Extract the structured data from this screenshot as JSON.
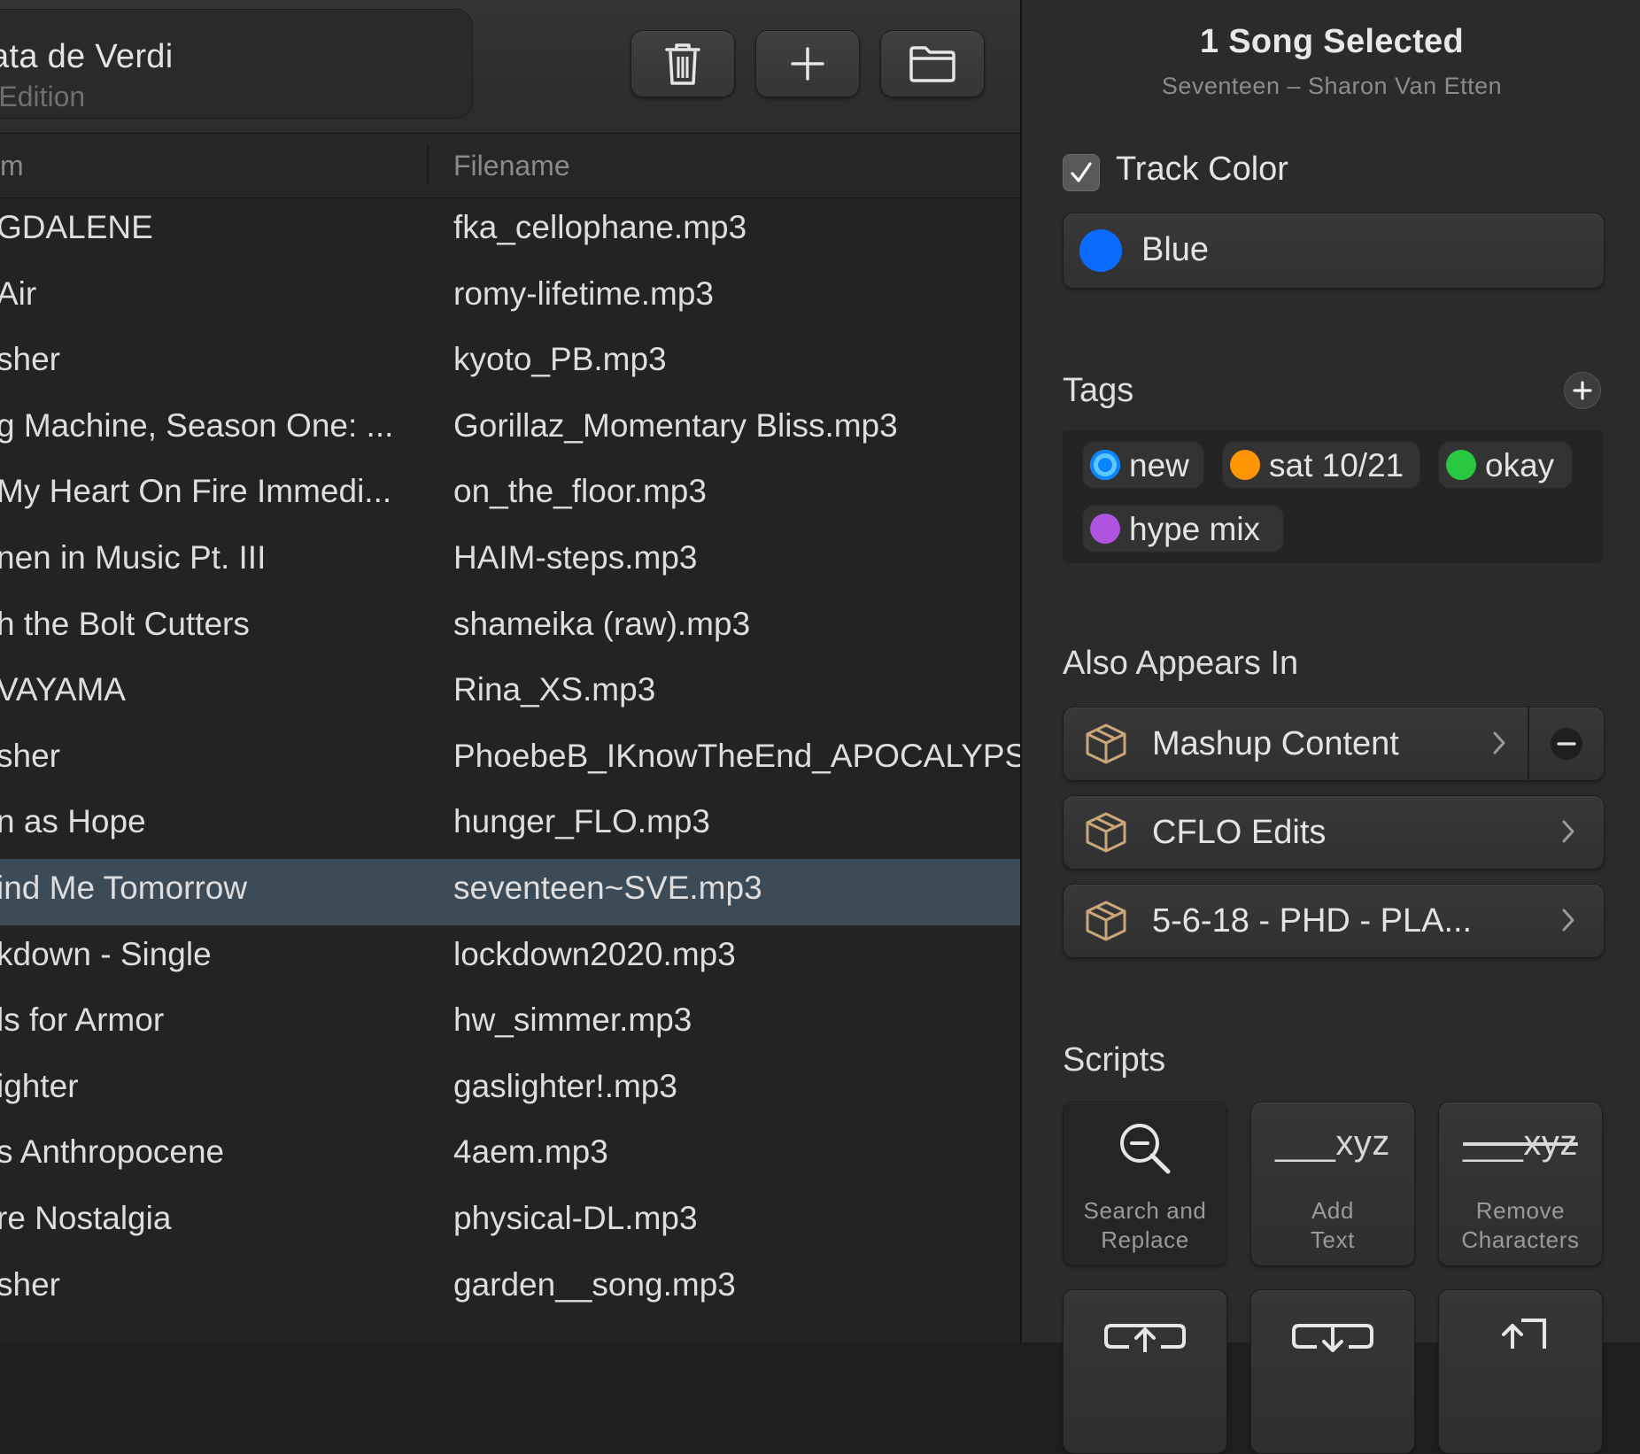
{
  "toolbar": {
    "title": "viata de Verdi",
    "subtitle": "ar Edition",
    "icons": [
      "trash-icon",
      "plus-icon",
      "folder-icon"
    ]
  },
  "columns": {
    "album": "m",
    "filename": "Filename"
  },
  "rows": [
    {
      "album": "GDALENE",
      "filename": "fka_cellophane.mp3"
    },
    {
      "album": "Air",
      "filename": "romy-lifetime.mp3"
    },
    {
      "album": "sher",
      "filename": "kyoto_PB.mp3"
    },
    {
      "album": "g Machine, Season One: ...",
      "filename": "Gorillaz_Momentary Bliss.mp3"
    },
    {
      "album": "My Heart On Fire Immedi...",
      "filename": "on_the_floor.mp3"
    },
    {
      "album": "nen in Music Pt. III",
      "filename": "HAIM-steps.mp3"
    },
    {
      "album": "h the Bolt Cutters",
      "filename": "shameika (raw).mp3"
    },
    {
      "album": "VAYAMA",
      "filename": "Rina_XS.mp3"
    },
    {
      "album": "sher",
      "filename": "PhoebeB_IKnowTheEnd_APOCALYPSE"
    },
    {
      "album": "n as Hope",
      "filename": "hunger_FLO.mp3"
    },
    {
      "album": "ind Me Tomorrow",
      "filename": "seventeen~SVE.mp3",
      "selected": true
    },
    {
      "album": "kdown - Single",
      "filename": "lockdown2020.mp3"
    },
    {
      "album": "ls for Armor",
      "filename": "hw_simmer.mp3"
    },
    {
      "album": "ighter",
      "filename": "gaslighter!.mp3"
    },
    {
      "album": "s Anthropocene",
      "filename": "4aem.mp3"
    },
    {
      "album": "re Nostalgia",
      "filename": "physical-DL.mp3"
    },
    {
      "album": "sher",
      "filename": "garden__song.mp3"
    }
  ],
  "inspector": {
    "title": "1 Song Selected",
    "subtitle": "Seventeen – Sharon Van Etten",
    "track_color": {
      "label": "Track Color",
      "checked": true,
      "value": "Blue",
      "color": "#0a6cff"
    },
    "tags": {
      "heading": "Tags",
      "items": [
        {
          "label": "new",
          "color": "#0a84ff"
        },
        {
          "label": "sat 10/21",
          "color": "#ff9500"
        },
        {
          "label": "okay",
          "color": "#28c840"
        },
        {
          "label": "hype mix",
          "color": "#af52de"
        }
      ]
    },
    "also_appears": {
      "heading": "Also Appears In",
      "items": [
        {
          "label": "Mashup Content"
        },
        {
          "label": "CFLO Edits"
        },
        {
          "label": "5-6-18 - PHD - PLA..."
        }
      ]
    },
    "scripts": {
      "heading": "Scripts",
      "items": [
        {
          "line1": "Search and",
          "line2": "Replace",
          "icon": "search-replace-icon"
        },
        {
          "line1": "Add",
          "line2": "Text",
          "glyph": "___xyz",
          "icon": "add-text-icon"
        },
        {
          "line1": "Remove",
          "line2": "Characters",
          "glyph": "___xyz",
          "icon": "remove-characters-icon"
        }
      ]
    }
  }
}
